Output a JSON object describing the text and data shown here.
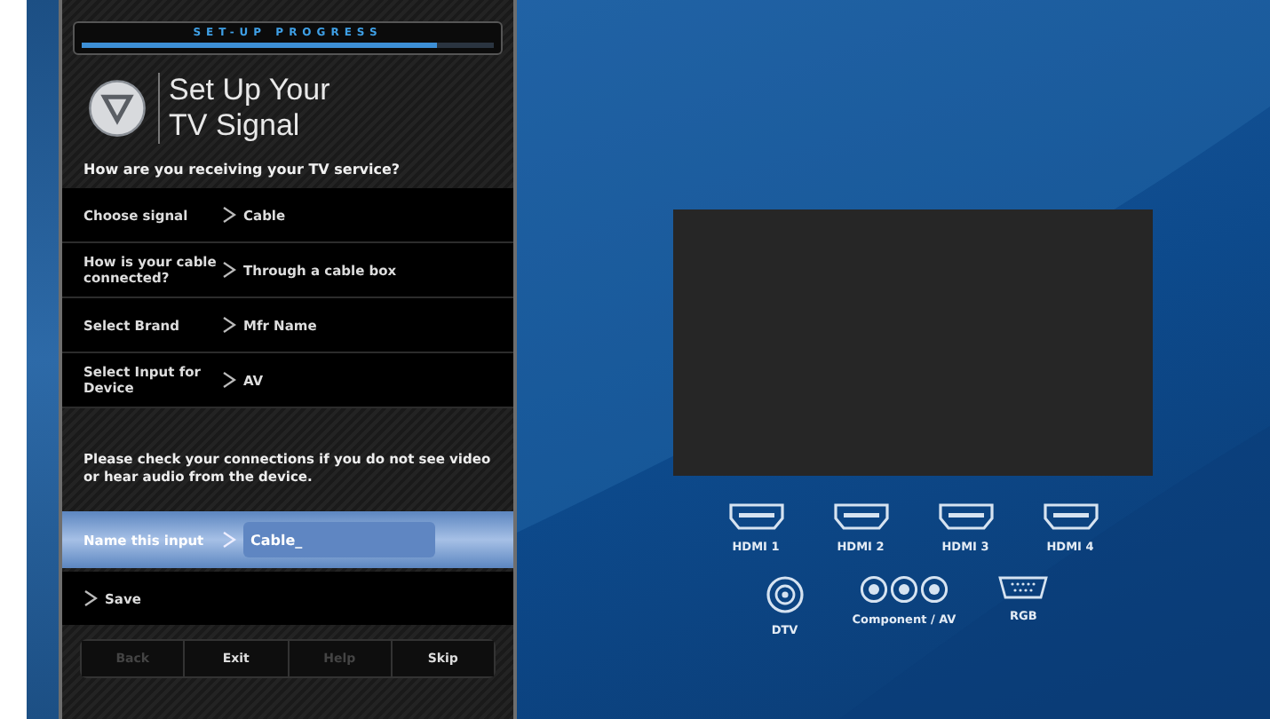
{
  "progress": {
    "label": "SET-UP PROGRESS",
    "level": 0.86
  },
  "title": [
    "Set Up Your",
    "TV Signal"
  ],
  "question": "How are you receiving your TV service?",
  "steps": [
    {
      "label": "Choose signal",
      "value": "Cable"
    },
    {
      "label": "How is your cable connected?",
      "value": "Through a cable box"
    },
    {
      "label": "Select Brand",
      "value": "Mfr Name"
    },
    {
      "label": "Select Input for Device",
      "value": "AV"
    }
  ],
  "notice": "Please check your connections if you do not see video or hear audio from the device.",
  "name_input": {
    "label": "Name this input",
    "value": "Cable_",
    "selected": true
  },
  "save": {
    "label": "Save"
  },
  "footer_buttons": [
    {
      "label": "Back",
      "disabled": true
    },
    {
      "label": "Exit",
      "disabled": false
    },
    {
      "label": "Help",
      "disabled": true
    },
    {
      "label": "Skip",
      "disabled": false
    }
  ],
  "ports_top": [
    {
      "kind": "hdmi",
      "label": "HDMI 1"
    },
    {
      "kind": "hdmi",
      "label": "HDMI 2"
    },
    {
      "kind": "hdmi",
      "label": "HDMI 3"
    },
    {
      "kind": "hdmi",
      "label": "HDMI 4"
    }
  ],
  "ports_bottom": [
    {
      "kind": "coax",
      "label": "DTV"
    },
    {
      "kind": "rca",
      "label": "Component / AV"
    },
    {
      "kind": "vga",
      "label": "RGB"
    }
  ]
}
